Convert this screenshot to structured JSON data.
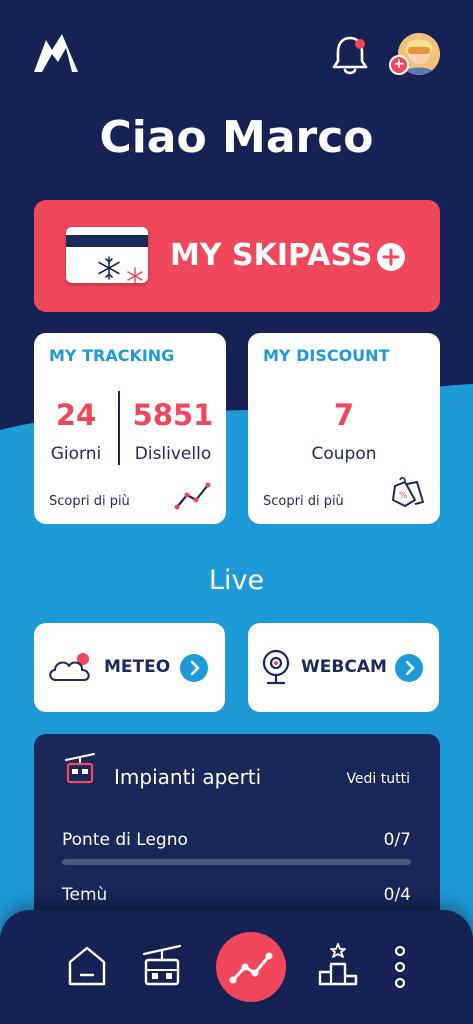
{
  "header": {
    "greeting": "Ciao Marco"
  },
  "skipass": {
    "label": "MY SKIPASS"
  },
  "tracking": {
    "title": "MY TRACKING",
    "days_value": "24",
    "days_label": "Giorni",
    "elevation_value": "5851",
    "elevation_label": "Dislivello",
    "more": "Scopri  di più"
  },
  "discount": {
    "title": "MY DISCOUNT",
    "coupon_value": "7",
    "coupon_label": "Coupon",
    "more": "Scopri di più"
  },
  "live": {
    "title": "Live",
    "meteo_label": "METEO",
    "webcam_label": "WEBCAM"
  },
  "lifts": {
    "title": "Impianti aperti",
    "see_all": "Vedi tutti",
    "items": [
      {
        "name": "Ponte di Legno",
        "count": "0/7",
        "open": 0,
        "total": 7
      },
      {
        "name": "Temù",
        "count": "0/4",
        "open": 0,
        "total": 4
      }
    ]
  },
  "colors": {
    "navy": "#152253",
    "sky_blue": "#1e9bd7",
    "coral": "#f1475b"
  },
  "icons": {
    "logo": "mountain-logo-icon",
    "notifications": "bell-icon",
    "avatar_add": "plus-icon",
    "meteo": "cloud-sun-icon",
    "webcam": "webcam-icon",
    "lifts": "cable-car-icon",
    "nav": [
      "home-icon",
      "cable-car-icon",
      "tracking-chart-icon",
      "podium-icon",
      "more-vertical-icon"
    ]
  }
}
